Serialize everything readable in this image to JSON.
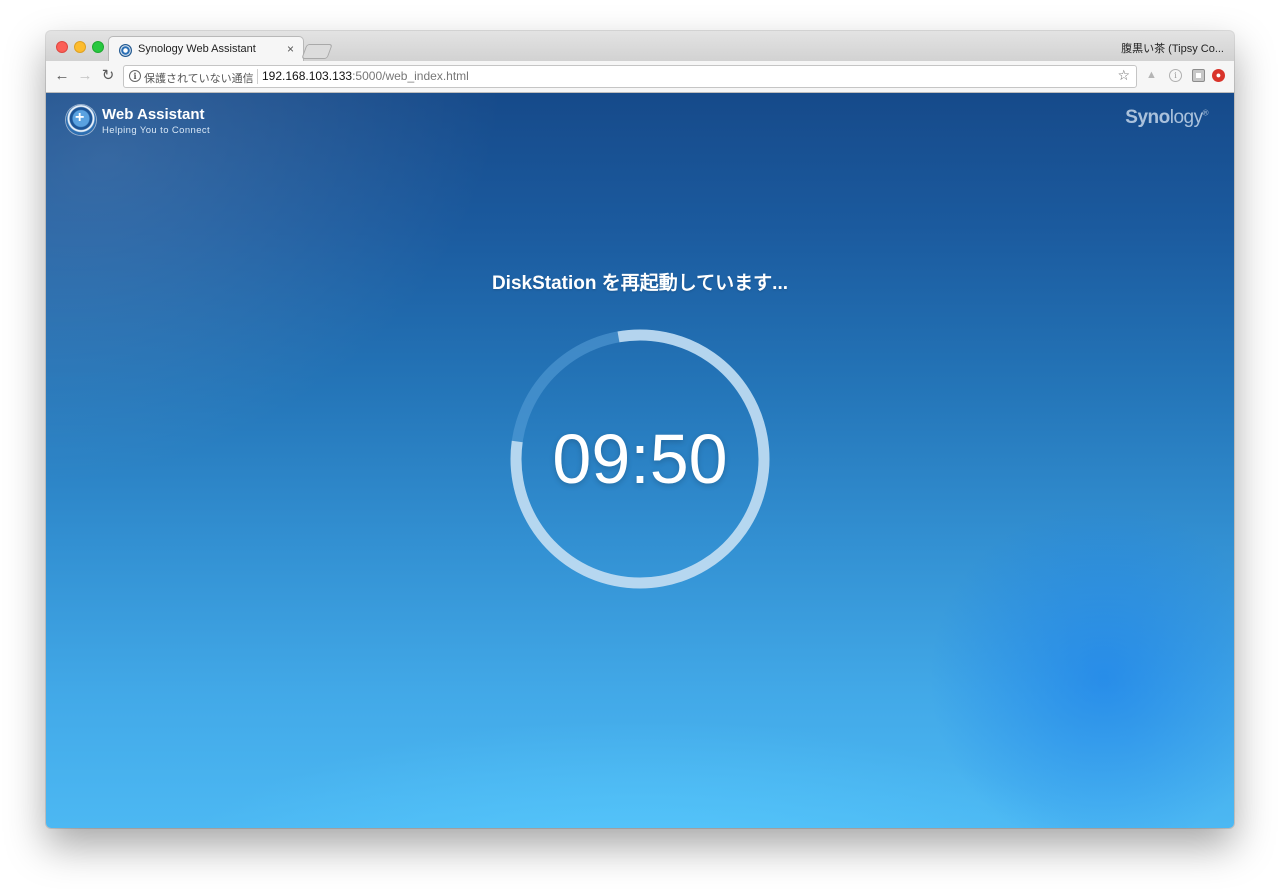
{
  "browser": {
    "tab_title": "Synology Web Assistant",
    "tab_close": "×",
    "profile_name": "腹黒い茶 (Tipsy Co...",
    "security_label": "保護されていない通信",
    "url_host": "192.168.103.133",
    "url_rest": ":5000/web_index.html",
    "nav": {
      "back": "←",
      "forward": "→",
      "reload": "↻"
    },
    "star": "☆",
    "info_glyph": "i",
    "adblock_glyph": "●",
    "drive_glyph": "▲"
  },
  "page": {
    "brand_title": "Web Assistant",
    "brand_subtitle": "Helping You to Connect",
    "vendor_bold": "Syno",
    "vendor_light": "logy",
    "vendor_mark": "®",
    "status_message": "DiskStation を再起動しています...",
    "countdown": "09:50",
    "progress_fraction": 0.8
  },
  "colors": {
    "accent": "#2f88cc",
    "ring_track": "#5aa0d8",
    "ring_progress": "#c9e2f5"
  }
}
